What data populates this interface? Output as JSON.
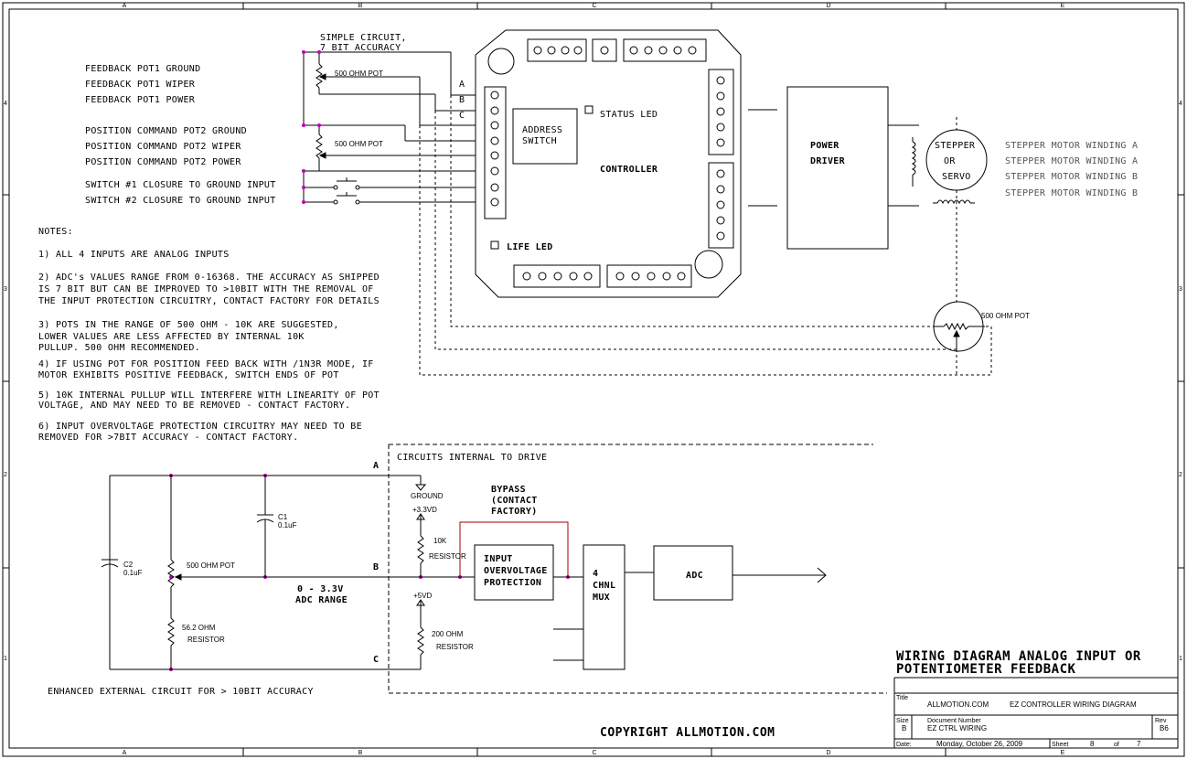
{
  "border": {
    "columns": [
      "A",
      "B",
      "C",
      "D",
      "E"
    ],
    "rows": [
      "4",
      "3",
      "2",
      "1"
    ]
  },
  "top_circuit": {
    "simple_circuit_label": [
      "SIMPLE CIRCUIT,",
      "7 BIT ACCURACY"
    ],
    "pot1_label": "500 OHM POT",
    "pot2_label": "500 OHM POT",
    "wires": [
      "FEEDBACK POT1 GROUND",
      "FEEDBACK POT1 WIPER",
      "FEEDBACK POT1 POWER",
      "POSITION COMMAND POT2 GROUND",
      "POSITION COMMAND POT2 WIPER",
      "POSITION COMMAND POT2 POWER",
      "SWITCH #1 CLOSURE TO GROUND INPUT",
      "SWITCH #2 CLOSURE TO GROUND INPUT"
    ],
    "connector_letters": [
      "A",
      "B",
      "C"
    ]
  },
  "controller": {
    "address_switch": [
      "ADDRESS",
      "SWITCH"
    ],
    "status_led": "STATUS LED",
    "controller_label": "CONTROLLER",
    "life_led": "LIFE LED"
  },
  "power_driver": [
    "POWER",
    "DRIVER"
  ],
  "motor": {
    "circle_text": [
      "STEPPER",
      "OR",
      "SERVO"
    ],
    "windings": [
      "STEPPER MOTOR WINDING A",
      "STEPPER MOTOR WINDING A",
      "STEPPER MOTOR WINDING B",
      "STEPPER MOTOR WINDING B"
    ],
    "feedback_pot": "500 OHM POT"
  },
  "notes": [
    "NOTES:",
    "1) ALL 4 INPUTS ARE ANALOG INPUTS",
    "2) ADC's VALUES RANGE FROM 0-16368. THE ACCURACY AS SHIPPED",
    "IS 7 BIT BUT CAN BE IMPROVED TO >10BIT WITH THE REMOVAL OF",
    "THE INPUT PROTECTION CIRCUITRY, CONTACT FACTORY FOR DETAILS",
    "3) POTS IN THE RANGE OF 500 OHM - 10K ARE SUGGESTED,",
    "LOWER VALUES ARE LESS AFFECTED BY INTERNAL 10K",
    "PULLUP. 500 OHM RECOMMENDED.",
    "4) IF USING POT FOR POSITION FEED BACK WITH /1N3R MODE, IF",
    " MOTOR EXHIBITS POSITIVE FEEDBACK, SWITCH ENDS OF POT",
    "5) 10K INTERNAL PULLUP WILL INTERFERE WITH LINEARITY OF POT",
    "VOLTAGE, AND MAY NEED TO BE REMOVED - CONTACT FACTORY.",
    "6) INPUT OVERVOLTAGE PROTECTION CIRCUITRY MAY NEED TO BE",
    "REMOVED FOR >7BIT ACCURACY - CONTACT FACTORY."
  ],
  "bottom_circuit": {
    "internal_label": "CIRCUITS INTERNAL TO DRIVE",
    "node_a": "A",
    "node_b": "B",
    "node_c": "C",
    "c1": [
      "C1",
      "0.1uF"
    ],
    "c2": [
      "C2",
      "0.1uF"
    ],
    "pot": "500 OHM POT",
    "resistor_56": [
      "56.2 OHM",
      "RESISTOR"
    ],
    "adc_range": [
      "0 - 3.3V",
      "ADC RANGE"
    ],
    "ground": "GROUND",
    "v33": "+3.3VD",
    "r10k": [
      "10K",
      "RESISTOR"
    ],
    "v5": "+5VD",
    "r200": [
      "200 OHM",
      "RESISTOR"
    ],
    "bypass": [
      "BYPASS",
      "(CONTACT",
      "FACTORY)"
    ],
    "protection": [
      "INPUT",
      "OVERVOLTAGE",
      "PROTECTION"
    ],
    "mux": [
      "4",
      "CHNL",
      "MUX"
    ],
    "adc": "ADC",
    "enhanced_label": "ENHANCED EXTERNAL CIRCUIT FOR > 10BIT ACCURACY"
  },
  "copyright": "COPYRIGHT ALLMOTION.COM",
  "title_block": {
    "title_lines": [
      "WIRING DIAGRAM ANALOG INPUT OR",
      "POTENTIOMETER FEEDBACK"
    ],
    "title_label": "Title",
    "company": "ALLMOTION.COM",
    "drawing_title": "EZ CONTROLLER WIRING DIAGRAM",
    "size_label": "Size",
    "size": "B",
    "doc_label": "Document Number",
    "doc_number": "EZ CTRL WIRING",
    "rev_label": "Rev",
    "rev": "B6",
    "date_label": "Date:",
    "date": "Monday, October 26, 2009",
    "sheet_label": "Sheet",
    "sheet": "8",
    "of_label": "of",
    "of": "7"
  }
}
